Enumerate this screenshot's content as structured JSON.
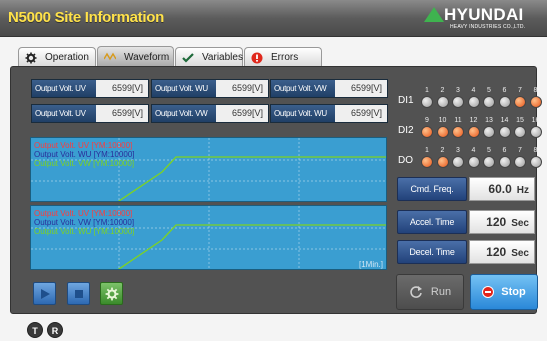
{
  "title": "N5000 Site Information",
  "brand": {
    "name": "HYUNDAI",
    "sub": "HEAVY INDUSTRIES CO.,LTD."
  },
  "tabs": [
    {
      "label": "Operation",
      "icon": "gear-icon"
    },
    {
      "label": "Waveform",
      "icon": "wave-icon",
      "active": true
    },
    {
      "label": "Variables",
      "icon": "check-icon"
    },
    {
      "label": "Errors",
      "icon": "error-icon"
    }
  ],
  "outputs": [
    {
      "label": "Output Volt. UV",
      "value": "6599[V]"
    },
    {
      "label": "Output Volt. WU",
      "value": "6599[V]"
    },
    {
      "label": "Output Volt. VW",
      "value": "6599[V]"
    },
    {
      "label": "Output Volt. UV",
      "value": "6599[V]"
    },
    {
      "label": "Output Volt. VW",
      "value": "6599[V]"
    },
    {
      "label": "Output Volt. WU",
      "value": "6599[V]"
    }
  ],
  "chart1": {
    "legend": [
      "Output Volt. UV [YM:10000]",
      "Output Volt. WU [YM:10000]",
      "Output Volt. VW [YM:10000]"
    ]
  },
  "chart2": {
    "legend": [
      "Output Volt. UV [YM:10000]",
      "Output Volt. VW [YM:10000]",
      "Output Volt. WU [YM:10000]"
    ],
    "timescale": "[1Min.]"
  },
  "io": {
    "di1": {
      "label": "DI1",
      "numbers": [
        "1",
        "2",
        "3",
        "4",
        "5",
        "6",
        "7",
        "8"
      ],
      "states": [
        0,
        0,
        0,
        0,
        0,
        0,
        1,
        1
      ]
    },
    "di2": {
      "label": "DI2",
      "numbers": [
        "9",
        "10",
        "11",
        "12",
        "13",
        "14",
        "15",
        "16"
      ],
      "states": [
        1,
        1,
        1,
        1,
        0,
        0,
        0,
        0
      ]
    },
    "do": {
      "label": "DO",
      "numbers": [
        "1",
        "2",
        "3",
        "4",
        "5",
        "6",
        "7",
        "8"
      ],
      "states": [
        1,
        1,
        0,
        0,
        0,
        0,
        0,
        0
      ]
    }
  },
  "params": [
    {
      "label": "Cmd. Freq.",
      "value": "60.0",
      "unit": "Hz"
    },
    {
      "label": "Accel. Time",
      "value": "120",
      "unit": "Sec"
    },
    {
      "label": "Decel. Time",
      "value": "120",
      "unit": "Sec"
    }
  ],
  "run_label": "Run",
  "stop_label": "Stop",
  "footer": {
    "t": "T",
    "r": "R"
  },
  "colors": {
    "title": "#ffe24a",
    "led_on": "#e85418",
    "wave": "#7ed321",
    "chart_bg": "#3a9ed1"
  }
}
